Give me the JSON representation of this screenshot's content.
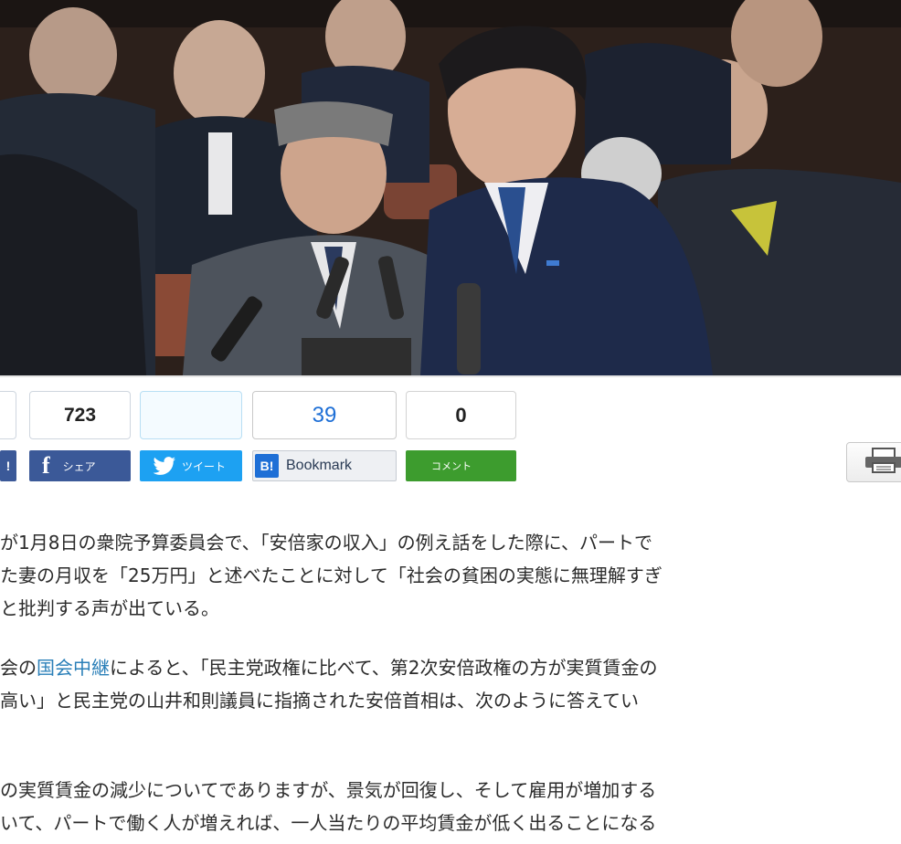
{
  "counts": {
    "first_partial": "",
    "facebook": "723",
    "twitter": "",
    "hatena": "39",
    "comments": "0"
  },
  "buttons": {
    "prev_label": "!",
    "facebook_icon": "f",
    "facebook_label": "シェア",
    "twitter_label": "ツイート",
    "hatena_icon": "B!",
    "hatena_label": "Bookmark",
    "comment_label": "コメント"
  },
  "icons": {
    "twitter": "bird-icon",
    "print": "printer-icon"
  },
  "article": {
    "p1": [
      "が1月8日の衆院予算委員会で、「安倍家の収入」の例え話をした際に、パートで",
      "た妻の月収を「25万円」と述べたことに対して「社会の貧困の実態に無理解すぎ",
      "と批判する声が出ている。"
    ],
    "p2_line1_before": "会の",
    "p2_link": "国会中継",
    "p2_line1_after": "によると、「民主党政権に比べて、第2次安倍政権の方が実質賃金の",
    "p2_line2": "高い」と民主党の山井和則議員に指摘された安倍首相は、次のように答えてい",
    "p3": [
      "の実質賃金の減少についてでありますが、景気が回復し、そして雇用が増加する",
      "いて、パートで働く人が増えれば、一人当たりの平均賃金が低く出ることになる"
    ]
  },
  "colors": {
    "facebook": "#3b5998",
    "twitter": "#1da1f2",
    "hatena": "#1e6fd6",
    "comment": "#3d9c2e",
    "link": "#2a7fb8"
  }
}
